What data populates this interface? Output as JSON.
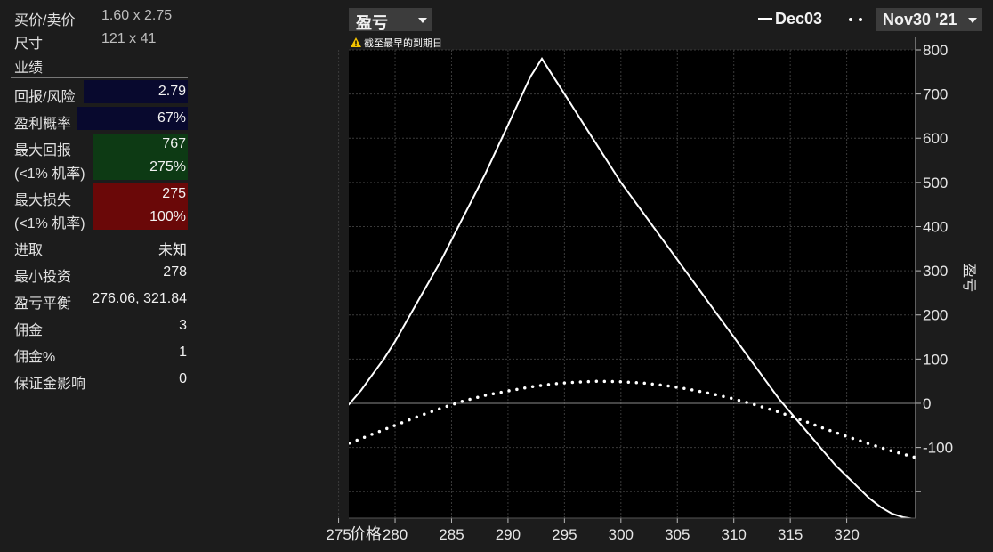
{
  "panel": {
    "bid_ask": {
      "label": "买价/卖价",
      "value": "1.60 x 2.75"
    },
    "size": {
      "label": "尺寸",
      "value": "121 x 41"
    },
    "section_title": "业绩",
    "return_risk": {
      "label": "回报/风险",
      "value": "2.79"
    },
    "prob_profit": {
      "label": "盈利概率",
      "value": "67%"
    },
    "max_return": {
      "label": "最大回报",
      "sub_label": "(<1% 机率)",
      "value": "767",
      "sub_value": "275%"
    },
    "max_loss": {
      "label": "最大损失",
      "sub_label": "(<1% 机率)",
      "value": "275",
      "sub_value": "100%"
    },
    "edge": {
      "label": "进取",
      "value": "未知"
    },
    "min_invest": {
      "label": "最小投资",
      "value": "278"
    },
    "breakeven": {
      "label": "盈亏平衡",
      "value": "276.06, 321.84"
    },
    "commission": {
      "label": "佣金",
      "value": "3"
    },
    "commission_pct": {
      "label": "佣金%",
      "value": "1"
    },
    "margin_impact": {
      "label": "保证金影响",
      "value": "0"
    }
  },
  "chart_controls": {
    "metric_select": "盈亏",
    "legend_solid": "Dec03",
    "legend_dotted_select": "Nov30 '21",
    "warning": "截至最早的到期日"
  },
  "colors": {
    "navy": "#08092e",
    "green": "#0d3a14",
    "red": "#6a0808",
    "plot_bg": "#000000",
    "line": "#ffffff"
  },
  "chart_data": {
    "type": "line",
    "ylabel": "盈亏",
    "xlabel": "价格:",
    "x_ticks": [
      275,
      280,
      285,
      290,
      295,
      300,
      305,
      310,
      315,
      320
    ],
    "y_ticks": [
      800,
      700,
      600,
      500,
      400,
      300,
      200,
      100,
      0,
      -100
    ],
    "xlim": [
      275.9,
      326.1
    ],
    "ylim": [
      -260,
      800
    ],
    "grid": true,
    "series": [
      {
        "name": "Dec03",
        "style": "solid",
        "x": [
          270,
          271,
          272,
          273,
          274,
          275,
          276,
          277,
          278,
          279,
          280,
          281,
          282,
          283,
          284,
          285,
          286,
          287,
          288,
          289,
          290,
          291,
          292,
          293,
          294,
          295,
          296,
          297,
          298,
          299,
          300,
          301,
          302,
          303,
          304,
          305,
          306,
          307,
          308,
          309,
          310,
          311,
          312,
          313,
          314,
          315,
          316,
          317,
          318,
          319,
          320,
          321,
          322,
          323,
          324,
          325,
          326
        ],
        "y": [
          -148,
          -125,
          -100,
          -78,
          -52,
          -25,
          0,
          30,
          65,
          100,
          140,
          185,
          230,
          275,
          320,
          370,
          420,
          470,
          520,
          575,
          630,
          685,
          740,
          780,
          740,
          700,
          660,
          620,
          580,
          540,
          500,
          465,
          430,
          395,
          360,
          325,
          290,
          255,
          220,
          185,
          150,
          115,
          80,
          45,
          10,
          -20,
          -50,
          -80,
          -110,
          -140,
          -165,
          -190,
          -215,
          -235,
          -250,
          -258,
          -262
        ]
      },
      {
        "name": "Nov30 '21",
        "style": "dotted",
        "x": [
          270,
          272,
          274,
          276,
          278,
          280,
          282,
          284,
          286,
          288,
          290,
          292,
          294,
          296,
          298,
          300,
          302,
          304,
          306,
          308,
          310,
          312,
          314,
          316,
          318,
          320,
          322,
          324,
          326
        ],
        "y": [
          -148,
          -130,
          -110,
          -90,
          -70,
          -50,
          -30,
          -12,
          5,
          18,
          28,
          37,
          44,
          48,
          50,
          49,
          46,
          40,
          32,
          22,
          10,
          -4,
          -20,
          -38,
          -57,
          -75,
          -92,
          -108,
          -122
        ]
      }
    ]
  }
}
